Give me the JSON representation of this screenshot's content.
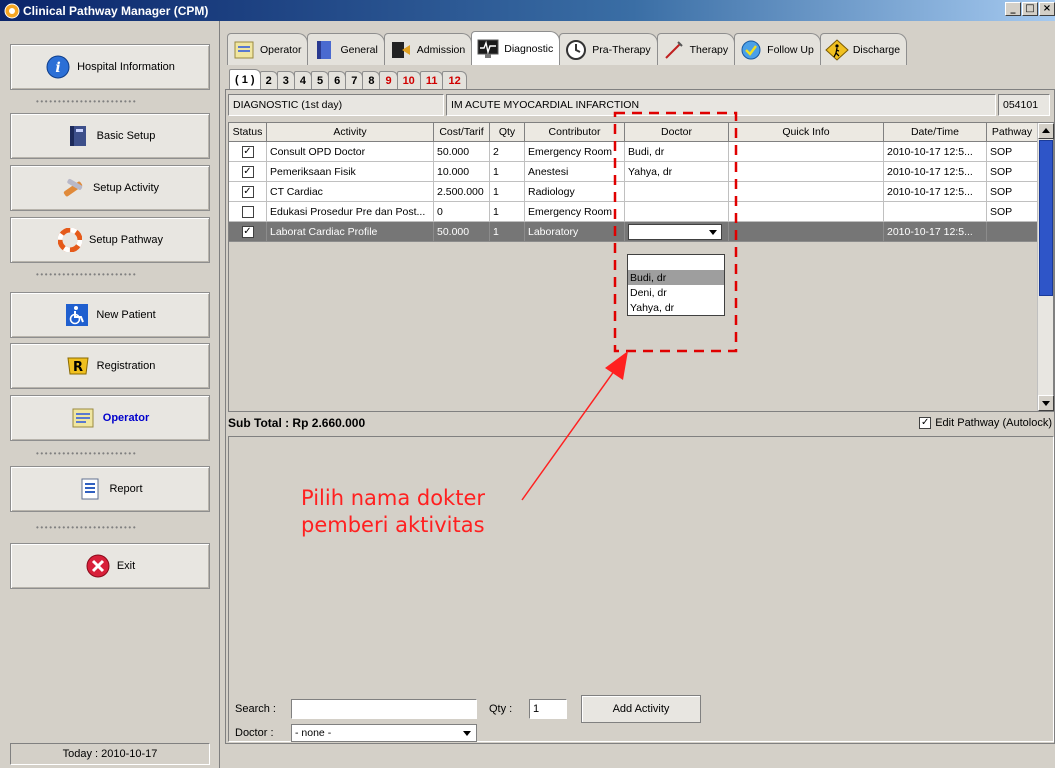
{
  "window": {
    "title": "Clinical Pathway Manager (CPM)",
    "controls": [
      "_",
      "□",
      "×"
    ]
  },
  "sidebar": {
    "buttons": [
      {
        "label": "Hospital Information",
        "icon": "info-icon"
      },
      {
        "label": "Basic Setup",
        "icon": "book-icon"
      },
      {
        "label": "Setup Activity",
        "icon": "tools-icon"
      },
      {
        "label": "Setup Pathway",
        "icon": "lifebuoy-icon"
      },
      {
        "label": "New Patient",
        "icon": "wheelchair-icon"
      },
      {
        "label": "Registration",
        "icon": "registration-icon"
      },
      {
        "label": "Operator",
        "icon": "operator-icon"
      },
      {
        "label": "Report",
        "icon": "report-icon"
      },
      {
        "label": "Exit",
        "icon": "exit-icon"
      }
    ],
    "separator": "•••••••••••••••••••••••",
    "today": "Today : 2010-10-17"
  },
  "tabs": [
    {
      "label": "Operator"
    },
    {
      "label": "General"
    },
    {
      "label": "Admission"
    },
    {
      "label": "Diagnostic"
    },
    {
      "label": "Pra-Therapy"
    },
    {
      "label": "Therapy"
    },
    {
      "label": "Follow Up"
    },
    {
      "label": "Discharge"
    }
  ],
  "day_tabs": [
    "( 1 )",
    "2",
    "3",
    "4",
    "5",
    "6",
    "7",
    "8",
    "9",
    "10",
    "11",
    "12"
  ],
  "info": {
    "stage": "DIAGNOSTIC  (1st day)",
    "diagnosis": "IM ACUTE MYOCARDIAL INFARCTION",
    "code": "054101"
  },
  "grid": {
    "columns": [
      "Status",
      "Activity",
      "Cost/Tarif",
      "Qty",
      "Contributor",
      "Doctor",
      "Quick Info",
      "Date/Time",
      "Pathway"
    ],
    "rows": [
      {
        "checked": "✓",
        "activity": "Consult OPD Doctor",
        "cost": "50.000",
        "qty": "2",
        "contributor": "Emergency Room",
        "doctor": "Budi, dr",
        "info": "",
        "datetime": "2010-10-17 12:5...",
        "pathway": "SOP"
      },
      {
        "checked": "✓",
        "activity": "Pemeriksaan Fisik",
        "cost": "10.000",
        "qty": "1",
        "contributor": "Anestesi",
        "doctor": "Yahya, dr",
        "info": "",
        "datetime": "2010-10-17 12:5...",
        "pathway": "SOP"
      },
      {
        "checked": "✓",
        "activity": "CT Cardiac",
        "cost": "2.500.000",
        "qty": "1",
        "contributor": "Radiology",
        "doctor": "",
        "info": "",
        "datetime": "2010-10-17 12:5...",
        "pathway": "SOP"
      },
      {
        "checked": "",
        "activity": "Edukasi Prosedur Pre dan Post...",
        "cost": "0",
        "qty": "1",
        "contributor": "Emergency Room",
        "doctor": "",
        "info": "",
        "datetime": "",
        "pathway": "SOP"
      },
      {
        "checked": "✓",
        "activity": "Laborat Cardiac Profile",
        "cost": "50.000",
        "qty": "1",
        "contributor": "Laboratory",
        "doctor": "",
        "info": "",
        "datetime": "2010-10-17 12:5...",
        "pathway": ""
      }
    ],
    "doctor_options": [
      "",
      "Budi, dr",
      "Deni, dr",
      "Yahya, dr"
    ]
  },
  "subtotal": "Sub Total : Rp 2.660.000",
  "autolock": {
    "label": "Edit Pathway (Autolock)",
    "checked": "✓"
  },
  "annotation": {
    "line1": "Pilih nama dokter",
    "line2": "pemberi aktivitas"
  },
  "form": {
    "search_label": "Search :",
    "search_value": "",
    "qty_label": "Qty :",
    "qty_value": "1",
    "add_button": "Add Activity",
    "doctor_label": "Doctor :",
    "doctor_value": "- none -"
  },
  "colors": {
    "title_bar": "#0a246a",
    "selected_row": "#767676",
    "annotation": "#ff2020",
    "red_tab": "#d00000",
    "active_operator": "#0000cc"
  }
}
